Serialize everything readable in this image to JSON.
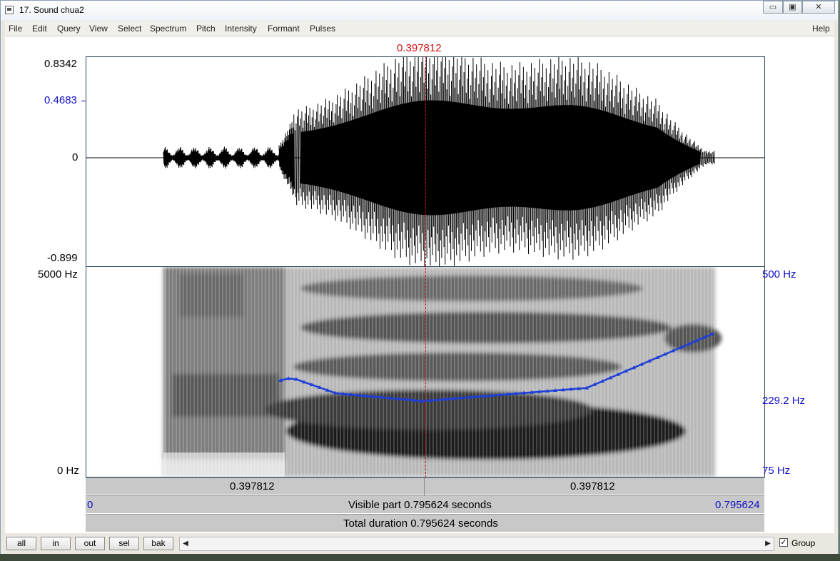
{
  "window": {
    "title": "17. Sound chua2",
    "controls": {
      "minimize": "▭",
      "maximize": "▣",
      "close": "✕"
    }
  },
  "menu": {
    "items": [
      "File",
      "Edit",
      "Query",
      "View",
      "Select",
      "Spectrum",
      "Pitch",
      "Intensity",
      "Formant",
      "Pulses"
    ],
    "help": "Help"
  },
  "cursor_time": "0.397812",
  "waveform": {
    "y_max": "0.8342",
    "y_marker": "0.4683",
    "y_zero": "0",
    "y_min": "-0.899"
  },
  "spectrogram": {
    "freq_top": "5000 Hz",
    "freq_bottom": "0 Hz",
    "pitch_top": "500 Hz",
    "pitch_value": "229.2 Hz",
    "pitch_bottom": "75 Hz"
  },
  "timebar": {
    "left_segment": "0.397812",
    "right_segment": "0.397812",
    "visible_start": "0",
    "visible_label": "Visible part 0.795624 seconds",
    "visible_end": "0.795624",
    "total_label": "Total duration 0.795624 seconds"
  },
  "buttons": {
    "all": "all",
    "in": "in",
    "out": "out",
    "sel": "sel",
    "bak": "bak"
  },
  "group": {
    "label": "Group",
    "checked": true
  },
  "colors": {
    "pitch_curve": "#1f3fd8",
    "cursor": "#d01010",
    "axis_blue": "#1010c8"
  }
}
